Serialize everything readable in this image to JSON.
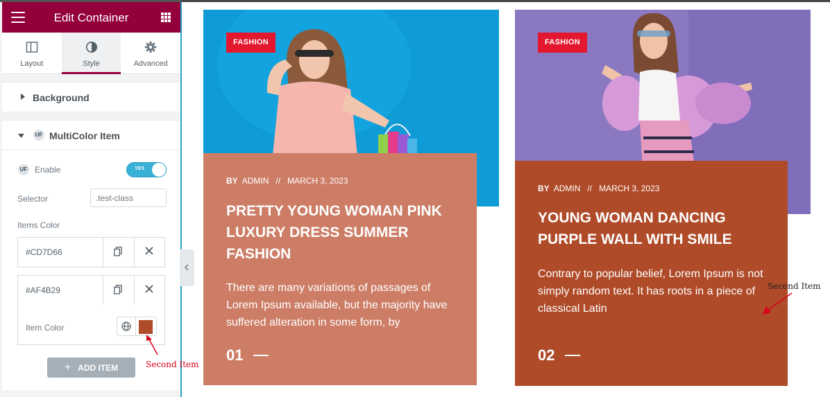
{
  "panel": {
    "title": "Edit Container",
    "tabs": [
      {
        "label": "Layout",
        "icon": "layout-icon"
      },
      {
        "label": "Style",
        "icon": "style-icon"
      },
      {
        "label": "Advanced",
        "icon": "gear-icon"
      }
    ],
    "active_tab": "Style",
    "accent_color": "#93003c",
    "sections": {
      "background": "Background",
      "multicolor": "MultiColor Item"
    },
    "enable_label": "Enable",
    "toggle_text": "YES",
    "selector_label": "Selector",
    "selector_placeholder": ".test-class",
    "items_color_label": "Items Color",
    "items": [
      {
        "value": "#CD7D66"
      },
      {
        "value": "#AF4B29"
      }
    ],
    "item_color_label": "Item Color",
    "item_color_value": "#AF4B29",
    "add_item_label": "ADD ITEM"
  },
  "annotations": {
    "panel_note": "Second Item",
    "card_note": "Second Item"
  },
  "cards": [
    {
      "tag": "FASHION",
      "by": "BY",
      "author": "ADMIN",
      "separator": "//",
      "date": "MARCH 3, 2023",
      "title": "PRETTY YOUNG WOMAN PINK LUXURY DRESS SUMMER FASHION",
      "description": "There are many variations of passages of Lorem Ipsum available, but the majority have suffered alteration in some form, by",
      "number": "01",
      "box_color": "#CD7D66",
      "image_bg": "#0e9bd6"
    },
    {
      "tag": "FASHION",
      "by": "BY",
      "author": "ADMIN",
      "separator": "//",
      "date": "MARCH 3, 2023",
      "title": "YOUNG WOMAN DANCING PURPLE WALL WITH SMILE",
      "description": "Contrary to popular belief, Lorem Ipsum is not simply random text. It has roots in a piece of classical Latin",
      "number": "02",
      "box_color": "#AF4B29",
      "image_bg": "#8a78c0"
    }
  ]
}
